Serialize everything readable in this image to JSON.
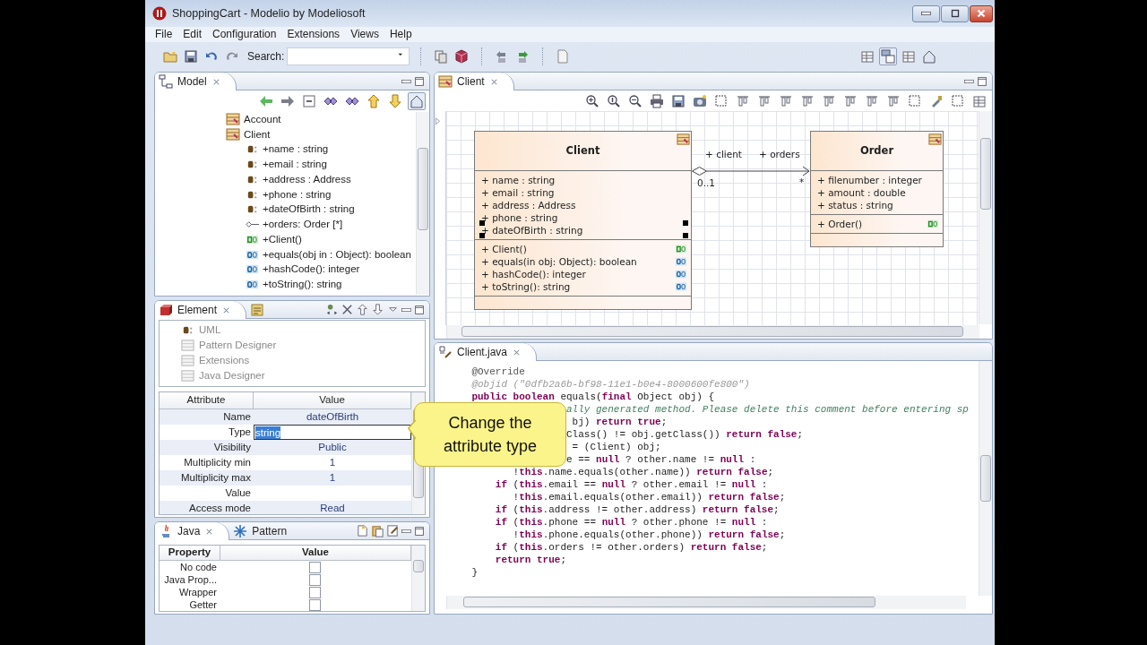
{
  "window": {
    "title": "ShoppingCart - Modelio by Modeliosoft"
  },
  "menu": [
    "File",
    "Edit",
    "Configuration",
    "Extensions",
    "Views",
    "Help"
  ],
  "toolbar": {
    "search_label": "Search:"
  },
  "model_panel": {
    "tab": "Model",
    "tree": [
      {
        "label": "Account",
        "kind": "class"
      },
      {
        "label": "Client",
        "kind": "class",
        "children": [
          {
            "label": "+name : string",
            "kind": "attribute"
          },
          {
            "label": "+email : string",
            "kind": "attribute"
          },
          {
            "label": "+address : Address",
            "kind": "attribute"
          },
          {
            "label": "+phone : string",
            "kind": "attribute"
          },
          {
            "label": "+dateOfBirth : string",
            "kind": "attribute"
          },
          {
            "label": "+orders: Order [*]",
            "kind": "association"
          },
          {
            "label": "+Client()",
            "kind": "constructor"
          },
          {
            "label": "+equals(obj in : Object): boolean",
            "kind": "operation"
          },
          {
            "label": "+hashCode(): integer",
            "kind": "operation"
          },
          {
            "label": "+toString(): string",
            "kind": "operation"
          }
        ]
      }
    ]
  },
  "element_panel": {
    "tabs": [
      {
        "label": "Element",
        "selected": true
      },
      {
        "selected": false
      }
    ],
    "modules": [
      {
        "label": "UML",
        "kind": "stereotype"
      },
      {
        "label": "Pattern Designer",
        "kind": "module"
      },
      {
        "label": "Extensions",
        "kind": "module"
      },
      {
        "label": "Java Designer",
        "kind": "module"
      }
    ],
    "columns": [
      "Attribute",
      "Value"
    ],
    "rows": [
      {
        "attribute": "Name",
        "value": "dateOfBirth",
        "editing": false
      },
      {
        "attribute": "Type",
        "value": "string",
        "editing": true
      },
      {
        "attribute": "Visibility",
        "value": "Public",
        "editing": false
      },
      {
        "attribute": "Multiplicity min",
        "value": "1",
        "editing": false
      },
      {
        "attribute": "Multiplicity max",
        "value": "1",
        "editing": false
      },
      {
        "attribute": "Value",
        "editing": false
      },
      {
        "attribute": "Access mode",
        "value": "Read",
        "editing": false
      }
    ]
  },
  "java_panel": {
    "tabs": [
      {
        "label": "Java",
        "selected": true
      },
      {
        "label": "Pattern",
        "selected": false
      }
    ],
    "columns": [
      "Property",
      "Value"
    ],
    "rows": [
      {
        "property": "No code",
        "checked": false
      },
      {
        "property": "Java Prop...",
        "checked": false
      },
      {
        "property": "Wrapper",
        "checked": false
      },
      {
        "property": "Getter",
        "checked": false
      }
    ]
  },
  "diagram": {
    "tab": "Client",
    "classes": [
      {
        "name": "Client",
        "attributes": [
          {
            "text": "+ name : string",
            "selected": false
          },
          {
            "text": "+ email : string",
            "selected": false
          },
          {
            "text": "+ address : Address",
            "selected": false
          },
          {
            "text": "+ phone : string",
            "selected": false
          },
          {
            "text": "+ dateOfBirth : string",
            "selected": true
          }
        ],
        "operations": [
          {
            "text": "+ Client()",
            "kind": "constructor"
          },
          {
            "text": "+ equals(in obj: Object): boolean",
            "kind": "operation"
          },
          {
            "text": "+ hashCode(): integer",
            "kind": "operation"
          },
          {
            "text": "+ toString(): string",
            "kind": "operation"
          }
        ]
      },
      {
        "name": "Order",
        "attributes": [
          {
            "text": "+ filenumber : integer",
            "selected": false
          },
          {
            "text": "+ amount : double",
            "selected": false
          },
          {
            "text": "+ status : string",
            "selected": false
          }
        ],
        "operations": [
          {
            "text": "+ Order()",
            "kind": "constructor"
          }
        ]
      }
    ],
    "association": {
      "source_role": "+ client",
      "target_role": "+ orders",
      "source_multiplicity": "0..1",
      "target_multiplicity": "*"
    }
  },
  "editor": {
    "tab": "Client.java",
    "lines": [
      {
        "segs": [
          {
            "text": "    @Override",
            "kind": "annotation"
          }
        ]
      },
      {
        "segs": [
          {
            "text": "    @objid (\"0dfb2a6b-bf98-11e1-b0e4-8000600fe800\")",
            "kind": "objid"
          }
        ]
      },
      {
        "segs": [
          {
            "text": "    public boolean",
            "kind": "keyword"
          },
          {
            "text": " equals(",
            "kind": "plain"
          },
          {
            "text": "final",
            "kind": "keyword"
          },
          {
            "text": " Object obj) {",
            "kind": "plain"
          }
        ]
      },
      {
        "segs": [
          {
            "text": "                    ally generated method. Please delete this comment before entering sp",
            "kind": "comment"
          }
        ]
      },
      {
        "segs": [
          {
            "text": "                     bj) ",
            "kind": "plain"
          },
          {
            "text": "return true",
            "kind": "keyword"
          },
          {
            "text": ";",
            "kind": "plain"
          }
        ]
      },
      {
        "segs": [
          {
            "text": "                    Class() != obj.getClass()) ",
            "kind": "plain"
          },
          {
            "text": "return false",
            "kind": "keyword"
          },
          {
            "text": ";",
            "kind": "plain"
          }
        ]
      },
      {
        "segs": [
          {
            "text": "                     = (Client) obj;",
            "kind": "plain"
          }
        ]
      },
      {
        "segs": [
          {
            "text": "                    e == ",
            "kind": "plain"
          },
          {
            "text": "null",
            "kind": "keyword"
          },
          {
            "text": " ? other.name != ",
            "kind": "plain"
          },
          {
            "text": "null",
            "kind": "keyword"
          },
          {
            "text": " :",
            "kind": "plain"
          }
        ]
      },
      {
        "segs": [
          {
            "text": "           !",
            "kind": "plain"
          },
          {
            "text": "this",
            "kind": "keyword"
          },
          {
            "text": ".name.equals(other.name)) ",
            "kind": "plain"
          },
          {
            "text": "return false",
            "kind": "keyword"
          },
          {
            "text": ";",
            "kind": "plain"
          }
        ]
      },
      {
        "segs": [
          {
            "text": "        if",
            "kind": "keyword"
          },
          {
            "text": " (",
            "kind": "plain"
          },
          {
            "text": "this",
            "kind": "keyword"
          },
          {
            "text": ".email == ",
            "kind": "plain"
          },
          {
            "text": "null",
            "kind": "keyword"
          },
          {
            "text": " ? other.email != ",
            "kind": "plain"
          },
          {
            "text": "null",
            "kind": "keyword"
          },
          {
            "text": " :",
            "kind": "plain"
          }
        ]
      },
      {
        "segs": [
          {
            "text": "           !",
            "kind": "plain"
          },
          {
            "text": "this",
            "kind": "keyword"
          },
          {
            "text": ".email.equals(other.email)) ",
            "kind": "plain"
          },
          {
            "text": "return false",
            "kind": "keyword"
          },
          {
            "text": ";",
            "kind": "plain"
          }
        ]
      },
      {
        "segs": [
          {
            "text": "        if",
            "kind": "keyword"
          },
          {
            "text": " (",
            "kind": "plain"
          },
          {
            "text": "this",
            "kind": "keyword"
          },
          {
            "text": ".address != other.address) ",
            "kind": "plain"
          },
          {
            "text": "return false",
            "kind": "keyword"
          },
          {
            "text": ";",
            "kind": "plain"
          }
        ]
      },
      {
        "segs": [
          {
            "text": "        if",
            "kind": "keyword"
          },
          {
            "text": " (",
            "kind": "plain"
          },
          {
            "text": "this",
            "kind": "keyword"
          },
          {
            "text": ".phone == ",
            "kind": "plain"
          },
          {
            "text": "null",
            "kind": "keyword"
          },
          {
            "text": " ? other.phone != ",
            "kind": "plain"
          },
          {
            "text": "null",
            "kind": "keyword"
          },
          {
            "text": " :",
            "kind": "plain"
          }
        ]
      },
      {
        "segs": [
          {
            "text": "           !",
            "kind": "plain"
          },
          {
            "text": "this",
            "kind": "keyword"
          },
          {
            "text": ".phone.equals(other.phone)) ",
            "kind": "plain"
          },
          {
            "text": "return false",
            "kind": "keyword"
          },
          {
            "text": ";",
            "kind": "plain"
          }
        ]
      },
      {
        "segs": [
          {
            "text": "        if",
            "kind": "keyword"
          },
          {
            "text": " (",
            "kind": "plain"
          },
          {
            "text": "this",
            "kind": "keyword"
          },
          {
            "text": ".orders != other.orders) ",
            "kind": "plain"
          },
          {
            "text": "return false",
            "kind": "keyword"
          },
          {
            "text": ";",
            "kind": "plain"
          }
        ]
      },
      {
        "segs": [
          {
            "text": "        return true",
            "kind": "keyword"
          },
          {
            "text": ";",
            "kind": "plain"
          }
        ]
      },
      {
        "segs": [
          {
            "text": "    }",
            "kind": "plain"
          }
        ]
      }
    ]
  },
  "callout": {
    "text": "Change the attribute type"
  }
}
